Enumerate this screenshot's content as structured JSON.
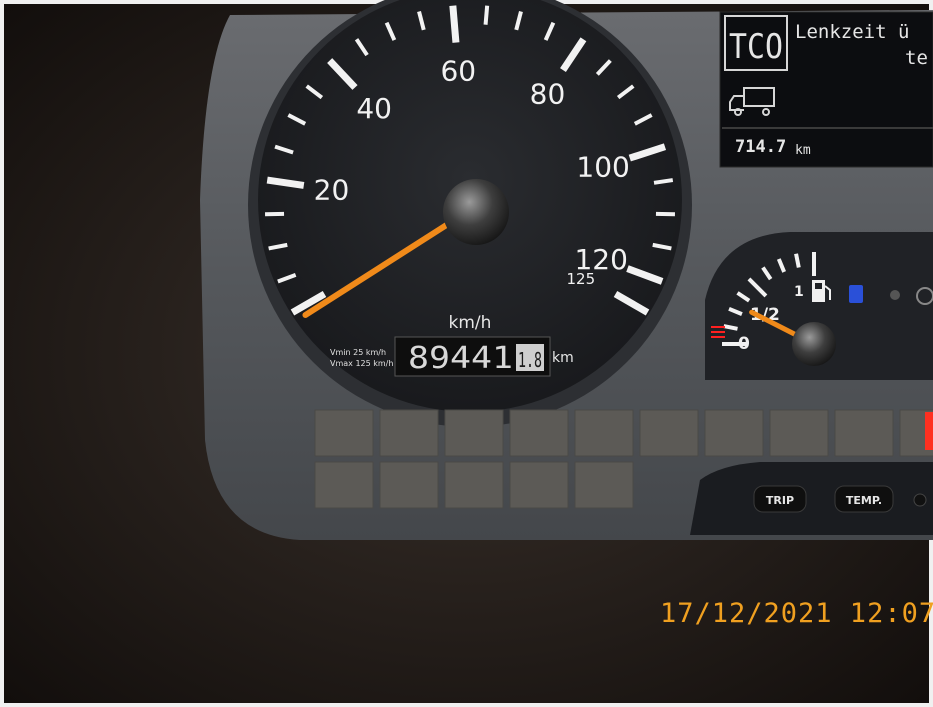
{
  "speedometer": {
    "unit": "km/h",
    "scale_labels": [
      "20",
      "40",
      "60",
      "80",
      "100",
      "120",
      "125"
    ],
    "needle_speed_kmh": 0,
    "vmin_line": "Vmin  25 km/h",
    "vmax_line": "Vmax 125 km/h"
  },
  "odometer": {
    "value": "89441",
    "decimal": "1.8",
    "unit": "km"
  },
  "tachograph_display": {
    "label": "TCO",
    "message_line1": "Lenkzeit ü",
    "message_line2": "te",
    "distance_value": "714.7",
    "distance_unit": "km"
  },
  "fuel_gauge": {
    "labels": [
      "0",
      "1/2",
      "1"
    ],
    "level_fraction": 0.3
  },
  "buttons": {
    "trip_label": "TRIP",
    "temp_label": "TEMP."
  },
  "timestamp": "17/12/2021  12:07",
  "colors": {
    "needle": "#f08a1a",
    "display_text": "#e8e8e8",
    "timestamp": "#f0a020",
    "fuel_icon": "#2a50d8",
    "warning_red": "#ff2020"
  }
}
